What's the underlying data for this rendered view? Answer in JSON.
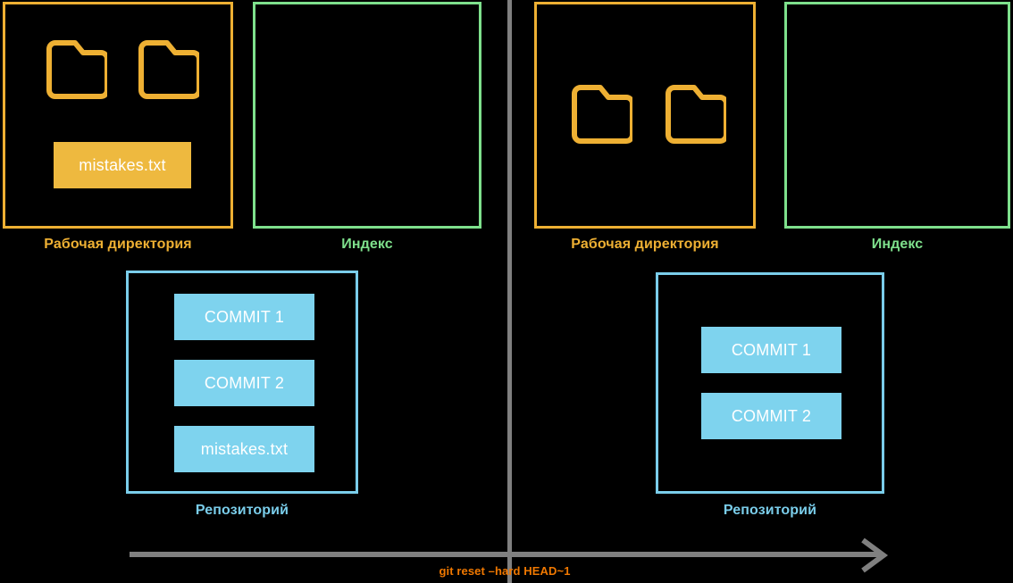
{
  "diagram": {
    "title_command": "git reset –hard HEAD~1",
    "colors": {
      "background": "#000000",
      "working_directory": "#eeb033",
      "index": "#7ee08c",
      "repository": "#7acdea",
      "file_chip": "#eeb93f",
      "commit_chip": "#7ed3ee",
      "divider": "#808080",
      "arrow": "#808080",
      "command_label": "#f07800",
      "chip_text": "#ffffff"
    }
  },
  "before": {
    "working_directory": {
      "label": "Рабочая директория",
      "folders": [
        "folder-icon",
        "folder-icon"
      ],
      "files": [
        "mistakes.txt"
      ]
    },
    "index": {
      "label": "Индекс",
      "items": []
    },
    "repository": {
      "label": "Репозиторий",
      "commits": [
        "COMMIT 1",
        "COMMIT 2",
        "mistakes.txt"
      ]
    }
  },
  "after": {
    "working_directory": {
      "label": "Рабочая директория",
      "folders": [
        "folder-icon",
        "folder-icon"
      ],
      "files": []
    },
    "index": {
      "label": "Индекс",
      "items": []
    },
    "repository": {
      "label": "Репозиторий",
      "commits": [
        "COMMIT 1",
        "COMMIT 2"
      ]
    }
  }
}
